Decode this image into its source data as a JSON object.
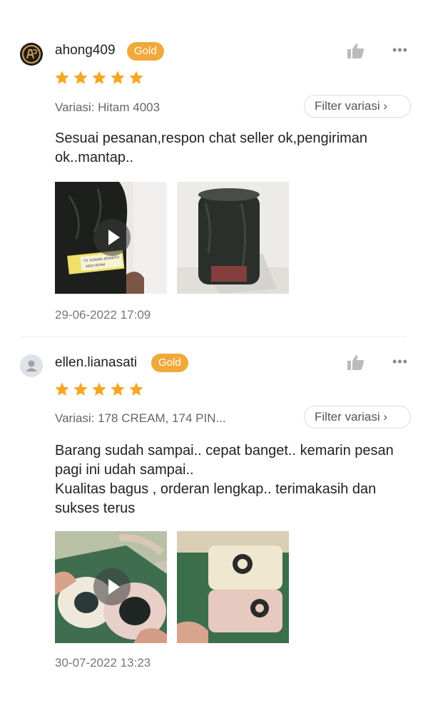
{
  "reviews": [
    {
      "username": "ahong409",
      "badge": "Gold",
      "rating": 5,
      "variation": "Variasi: Hitam 4003",
      "filter_label": "Filter variasi ›",
      "text": "Sesuai pesanan,respon chat seller ok,pengiriman ok..mantap..",
      "media": [
        {
          "type": "video",
          "label_text": "TX. KOKAN JAYANTO\n4003 HITAM"
        },
        {
          "type": "photo"
        }
      ],
      "date": "29-06-2022 17:09"
    },
    {
      "username": "ellen.lianasati",
      "badge": "Gold",
      "rating": 5,
      "variation": "Variasi: 178 CREAM, 174 PIN...",
      "filter_label": "Filter variasi ›",
      "text": "Barang sudah sampai.. cepat banget.. kemarin pesan pagi ini udah sampai..\nKualitas bagus , orderan lengkap.. terimakasih dan sukses terus",
      "media": [
        {
          "type": "video"
        },
        {
          "type": "photo"
        }
      ],
      "date": "30-07-2022 13:23"
    }
  ],
  "icons": {
    "like": "thumbs-up-icon",
    "more": "more-horizontal-icon",
    "star": "star-icon",
    "play": "play-icon"
  },
  "colors": {
    "badge": "#f0a93a",
    "star": "#f5a623"
  }
}
